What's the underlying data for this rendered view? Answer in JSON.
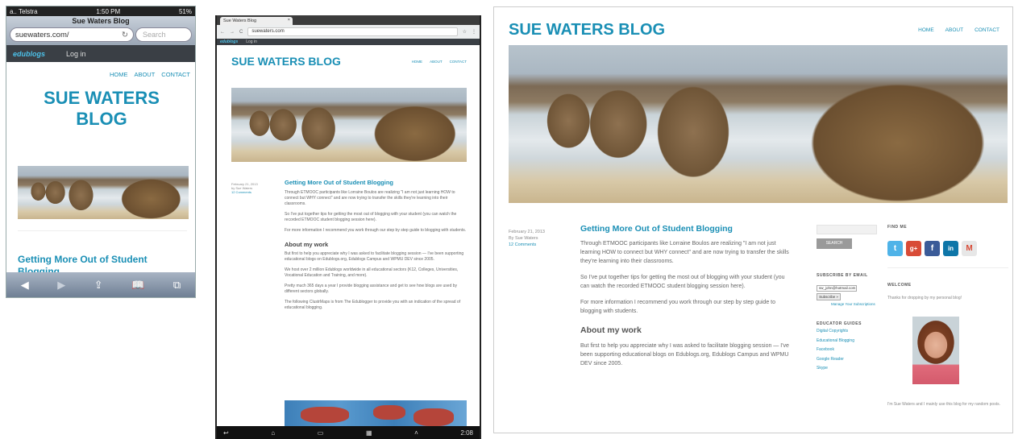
{
  "phone": {
    "status": {
      "carrier": "a.. Telstra",
      "time": "1:50 PM",
      "battery": "51%"
    },
    "page_title": "Sue Waters Blog",
    "url": "suewaters.com/",
    "search_placeholder": "Search",
    "admin_logo": "edublogs",
    "login": "Log in",
    "nav": [
      "HOME",
      "ABOUT",
      "CONTACT"
    ],
    "blog_title": "SUE WATERS BLOG",
    "post_title": "Getting More Out of Student Blogging"
  },
  "tablet": {
    "tab_title": "Sue Waters Blog",
    "url": "suewaters.com",
    "admin_logo": "edublogs",
    "login": "Log in",
    "blog_title": "SUE WATERS BLOG",
    "nav": [
      "HOME",
      "ABOUT",
      "CONTACT"
    ],
    "meta": {
      "date": "February 21, 2013",
      "author": "by Sue Waters",
      "comments": "12 Comments"
    },
    "post_title": "Getting More Out of Student Blogging",
    "paras": [
      "Through ETMOOC participants like Lorraine Boulos are realizing \"I am not just learning HOW to connect but WHY connect\" and are now trying to transfer the skills they're learning into their classrooms.",
      "So I've put together tips for getting the most out of blogging with your student (you can watch the recorded ETMOOC student blogging session here).",
      "For more information I recommend you work through our step by step guide to blogging with students."
    ],
    "about_heading": "About my work",
    "about_paras": [
      "But first to help you appreciate why I was asked to facilitate blogging session — I've been supporting educational blogs on Edublogs.org, Edublogs Campus and WPMU DEV since 2005.",
      "We host over 2 million Edublogs worldwide in all educational sectors (K12, Colleges, Universities, Vocational Education and Training, and more).",
      "Pretty much 365 days a year I provide blogging assistance and get to see how blogs are used by different sectors globally.",
      "The following ClustrMaps is from The Edublogger to provide you with an indication of the spread of educational blogging."
    ],
    "clock": "2:08"
  },
  "desktop": {
    "blog_title": "SUE WATERS BLOG",
    "nav": [
      "HOME",
      "ABOUT",
      "CONTACT"
    ],
    "meta": {
      "date": "February 21, 2013",
      "author": "By Sue Waters",
      "comments": "12 Comments"
    },
    "post_title": "Getting More Out of Student Blogging",
    "paras": [
      "Through ETMOOC participants like Lorraine Boulos are realizing \"I am not just learning HOW to connect but WHY connect\" and are now trying to transfer the skills they're learning into their classrooms.",
      "So I've put together tips for getting the most out of blogging with your student (you can watch the recorded ETMOOC student blogging session here).",
      "For more information I recommend you work through our step by step guide to blogging with students."
    ],
    "about_heading": "About my work",
    "about_para": "But first to help you appreciate why I was asked to facilitate blogging session — I've been supporting educational blogs on Edublogs.org, Edublogs Campus and WPMU DEV since 2005.",
    "search_button": "SEARCH",
    "subscribe_heading": "SUBSCRIBE BY EMAIL",
    "email_value": "sw_john@hotmail.com",
    "subscribe_button": "Subscribe »",
    "manage": "Manage Your Subscriptions",
    "guides_heading": "EDUCATOR GUIDES",
    "guides": [
      "Digital Copyrights",
      "Educational Blogging",
      "Facebook",
      "Google Reader",
      "Skype"
    ],
    "find_heading": "FIND ME",
    "social": [
      {
        "glyph": "t",
        "color": "#4fb3e8"
      },
      {
        "glyph": "g+",
        "color": "#d84b37"
      },
      {
        "glyph": "f",
        "color": "#3b5b98"
      },
      {
        "glyph": "in",
        "color": "#0e76a8"
      },
      {
        "glyph": "M",
        "color": "#e7e7e7"
      }
    ],
    "welcome_heading": "WELCOME",
    "welcome_text": "Thanks for dropping by my personal blog!",
    "bio": "I'm Sue Waters and I mainly use this blog for my random posts."
  }
}
